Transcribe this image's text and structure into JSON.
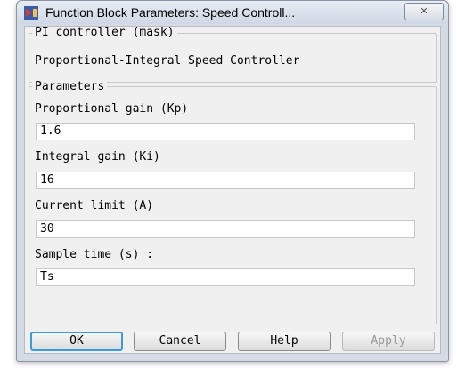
{
  "window": {
    "title": "Function Block Parameters: Speed Controll...",
    "close_symbol": "✕"
  },
  "mask": {
    "legend": "PI controller (mask)",
    "description": "Proportional-Integral Speed Controller"
  },
  "parameters": {
    "legend": "Parameters",
    "fields": [
      {
        "label": "Proportional gain (Kp)",
        "value": "1.6"
      },
      {
        "label": "Integral gain (Ki)",
        "value": "16"
      },
      {
        "label": "Current limit (A)",
        "value": "30"
      },
      {
        "label": "Sample time (s) :",
        "value": "Ts"
      }
    ]
  },
  "buttons": {
    "ok": "OK",
    "cancel": "Cancel",
    "help": "Help",
    "apply": "Apply"
  },
  "icons": {
    "app": "simulink-block-icon",
    "close": "close-icon"
  },
  "colors": {
    "default_button_border": "#3c9ad7",
    "disabled_text": "#9a9a9a"
  }
}
